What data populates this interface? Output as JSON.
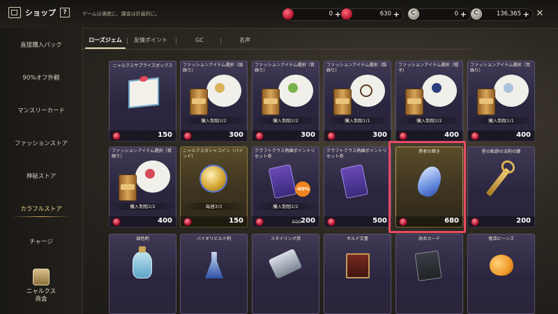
{
  "header": {
    "title": "ショップ",
    "help": "?",
    "notice": "ゲームは適度に、課金は計画的に。",
    "currencies": [
      {
        "icon": "rose-gem-icon",
        "value": "0"
      },
      {
        "icon": "ruby-icon",
        "value": "630"
      },
      {
        "icon": "coin-icon",
        "value": "0"
      },
      {
        "icon": "coin-icon",
        "value": "136,365"
      }
    ],
    "plus": "+",
    "close": "✕"
  },
  "sidebar": {
    "items": [
      {
        "label": "直接購入パック"
      },
      {
        "label": "90%オフ外観"
      },
      {
        "label": "マンスリーカード"
      },
      {
        "label": "ファッションストア"
      },
      {
        "label": "神秘ストア"
      },
      {
        "label": "カラフルストア",
        "active": true
      },
      {
        "label": "チャージ"
      }
    ],
    "bottom": "ニャルクス\n商会"
  },
  "tabs": [
    {
      "label": "ローズジェム",
      "active": true
    },
    {
      "label": "友情ポイント"
    },
    {
      "label": "GC"
    },
    {
      "label": "名声"
    }
  ],
  "items": [
    {
      "name": "ニャルクスサプライズボックス",
      "limit": "",
      "price": "150"
    },
    {
      "name": "ファッションアイテム選択（頭飾り）",
      "limit": "購入制限2/2",
      "price": "300"
    },
    {
      "name": "ファッションアイテム選択（首飾り）",
      "limit": "購入制限2/2",
      "price": "300"
    },
    {
      "name": "ファッションアイテム選択（顔飾り）",
      "limit": "購入制限1/1",
      "price": "300"
    },
    {
      "name": "ファッションアイテム選択（帽子）",
      "limit": "購入制限2/2",
      "price": "400"
    },
    {
      "name": "ファッションアイテム選択（耳飾り）",
      "limit": "購入制限1/1",
      "price": "400"
    },
    {
      "name": "ファッションアイテム選択（首飾り）",
      "limit": "購入制限2/2",
      "price": "400"
    },
    {
      "name": "ニャルクスガシャコイン（バインド）",
      "limit": "毎週3/3",
      "price": "150"
    },
    {
      "name": "クラフトクラス熟練ポイントリセット券",
      "limit": "購入制限2/2",
      "price": "200",
      "old_price": "500",
      "discount": "-60%"
    },
    {
      "name": "クラフトクラス熟練ポイントリセット券",
      "limit": "",
      "price": "500"
    },
    {
      "name": "勇者の輝き",
      "limit": "",
      "price": "680"
    },
    {
      "name": "星の軌跡の法則の鍵",
      "limit": "",
      "price": "200"
    },
    {
      "name": "調色剤"
    },
    {
      "name": "バイオリビルド剤"
    },
    {
      "name": "スタイリング券"
    },
    {
      "name": "ギルド文書"
    },
    {
      "name": "改名カード"
    },
    {
      "name": "復活ビーンズ"
    }
  ]
}
